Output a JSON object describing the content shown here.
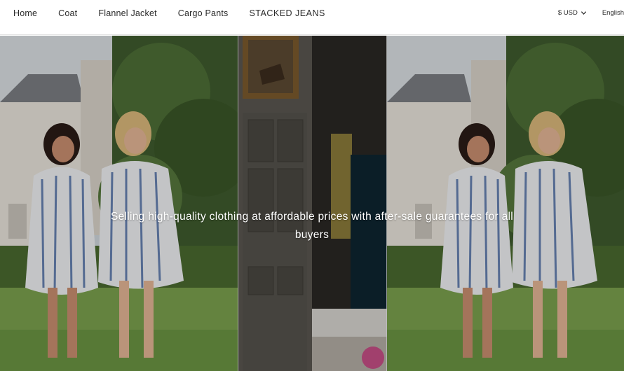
{
  "nav": {
    "items": [
      "Home",
      "Coat",
      "Flannel Jacket",
      "Cargo Pants",
      "STACKED JEANS"
    ]
  },
  "utility": {
    "currency": "$ USD",
    "language": "English"
  },
  "hero": {
    "tagline": "Selling high-quality clothing at affordable prices with after-sale guarantees for all buyers"
  },
  "colors": {
    "text": "#2b2b2b",
    "header_bg": "#ffffff",
    "hero_text": "#ffffff"
  },
  "icons": {
    "currency_dropdown": "chevron-down-icon"
  }
}
